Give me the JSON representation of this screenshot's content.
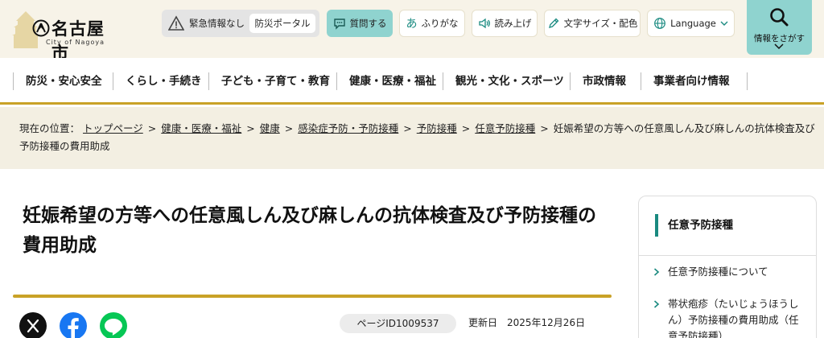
{
  "header": {
    "city_name": "名古屋市",
    "city_sub": "City of Nagoya",
    "emergency_text": "緊急情報なし",
    "disaster_portal": "防災ポータル",
    "ask_label": "質問する",
    "furigana_glyph": "あ",
    "furigana_label": "ふりがな",
    "read_aloud_label": "読み上げ",
    "text_size_label": "文字サイズ・配色",
    "language_label": "Language",
    "search_label": "情報をさがす"
  },
  "nav": {
    "items": [
      "防災・安心安全",
      "くらし・手続き",
      "子ども・子育て・教育",
      "健康・医療・福祉",
      "観光・文化・スポーツ",
      "市政情報",
      "事業者向け情報"
    ]
  },
  "breadcrumb": {
    "prefix": "現在の位置：",
    "links": [
      "トップページ",
      "健康・医療・福祉",
      "健康",
      "感染症予防・予防接種",
      "予防接種",
      "任意予防接種"
    ],
    "current": "妊娠希望の方等への任意風しん及び麻しんの抗体検査及び予防接種の費用助成",
    "separator": ">"
  },
  "main": {
    "title": "妊娠希望の方等への任意風しん及び麻しんの抗体検査及び予防接種の費用助成",
    "page_id": "ページID1009537",
    "updated": "更新日　2025年12月26日"
  },
  "sidebar": {
    "heading": "任意予防接種",
    "links": [
      "任意予防接種について",
      "帯状疱疹（たいじょうほうしん）予防接種の費用助成（任意予防接種）"
    ]
  },
  "colors": {
    "accent_teal": "#8fd3cf",
    "gold_rule": "#c9a227",
    "header_bg": "#f7f3e8"
  }
}
